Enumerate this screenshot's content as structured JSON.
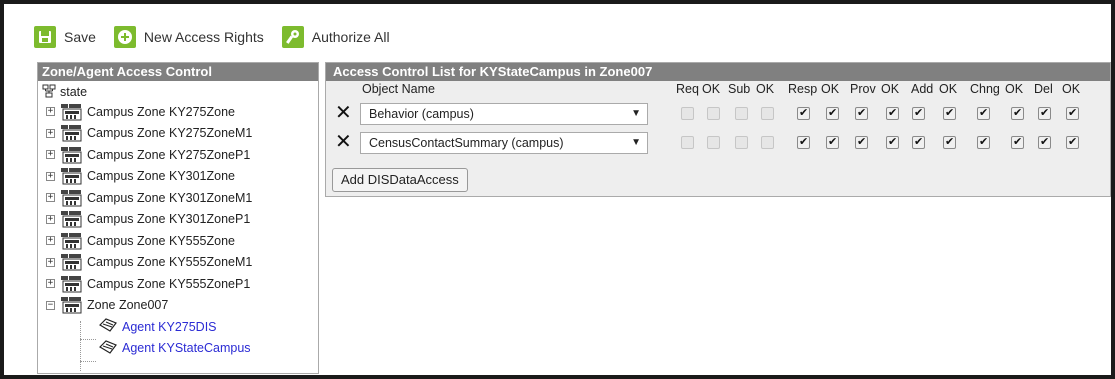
{
  "toolbar": {
    "save": {
      "label": "Save",
      "icon": "save-icon"
    },
    "new_access": {
      "label": "New Access Rights",
      "icon": "plus-icon"
    },
    "authorize": {
      "label": "Authorize All",
      "icon": "key-icon"
    },
    "accent": "#7dbb2e"
  },
  "zone_panel": {
    "title": "Zone/Agent Access Control",
    "root": "state",
    "zones": [
      {
        "label": "Campus Zone KY275Zone",
        "expanded": false
      },
      {
        "label": "Campus Zone KY275ZoneM1",
        "expanded": false
      },
      {
        "label": "Campus Zone KY275ZoneP1",
        "expanded": false
      },
      {
        "label": "Campus Zone KY301Zone",
        "expanded": false
      },
      {
        "label": "Campus Zone KY301ZoneM1",
        "expanded": false
      },
      {
        "label": "Campus Zone KY301ZoneP1",
        "expanded": false
      },
      {
        "label": "Campus Zone KY555Zone",
        "expanded": false
      },
      {
        "label": "Campus Zone KY555ZoneM1",
        "expanded": false
      },
      {
        "label": "Campus Zone KY555ZoneP1",
        "expanded": false
      },
      {
        "label": "Zone Zone007",
        "expanded": true
      }
    ],
    "agents": [
      {
        "label": "Agent KY275DIS"
      },
      {
        "label": "Agent KYStateCampus"
      }
    ]
  },
  "acl_panel": {
    "title": "Access Control List for KYStateCampus in Zone007",
    "columns": {
      "object_name": "Object Name",
      "req": "Req",
      "req_ok": "OK",
      "sub": "Sub",
      "sub_ok": "OK",
      "resp": "Resp",
      "resp_ok": "OK",
      "prov": "Prov",
      "prov_ok": "OK",
      "add": "Add",
      "add_ok": "OK",
      "chng": "Chng",
      "chng_ok": "OK",
      "del": "Del",
      "del_ok": "OK"
    },
    "rows": [
      {
        "object": "Behavior (campus)",
        "checks": [
          false,
          false,
          false,
          false,
          true,
          true,
          true,
          true,
          true,
          true,
          true,
          true,
          true,
          true
        ]
      },
      {
        "object": "CensusContactSummary (campus)",
        "checks": [
          false,
          false,
          false,
          false,
          true,
          true,
          true,
          true,
          true,
          true,
          true,
          true,
          true,
          true
        ]
      }
    ],
    "add_button": "Add DISDataAccess"
  }
}
